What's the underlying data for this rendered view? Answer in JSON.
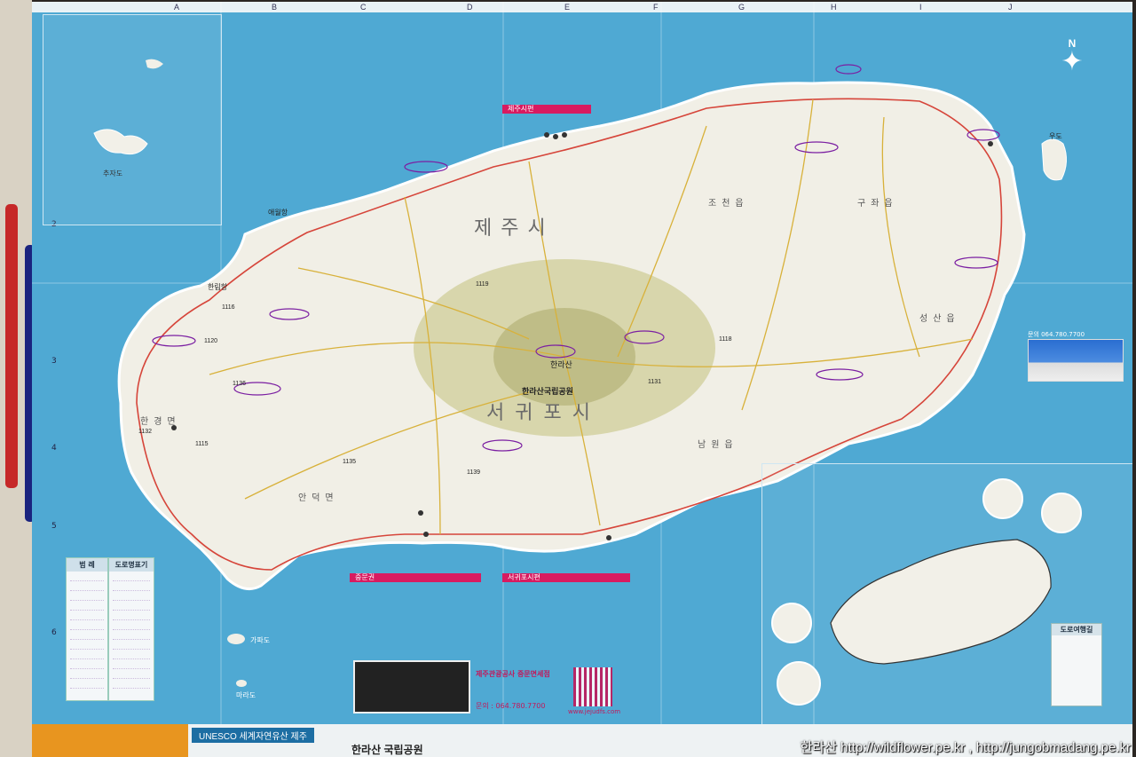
{
  "map": {
    "island_label": "제주시",
    "region_north": "제주시",
    "region_south": "서귀포시",
    "national_park_label": "한라산국립공원",
    "peak_label": "한라산",
    "compass_label": "N",
    "column_letters": [
      "A",
      "B",
      "C",
      "D",
      "E",
      "F",
      "G",
      "H",
      "I",
      "J"
    ],
    "row_numbers": [
      "2",
      "3",
      "4",
      "5",
      "6"
    ],
    "place_labels": {
      "aewol": "애월항",
      "hallim": "한림항",
      "hangyeong": "한경면",
      "andeok": "안덕면",
      "namwon": "남원읍",
      "jocheon": "조천읍",
      "gujwa": "구좌읍",
      "seongsan": "성산읍",
      "udo": "우도",
      "chuja": "추자도",
      "marado": "마라도",
      "gapado": "가파도"
    },
    "route_numbers": [
      "1132",
      "1116",
      "1136",
      "1139",
      "1119",
      "1118",
      "1131",
      "1135",
      "1120",
      "1115"
    ]
  },
  "panels": {
    "legend_title": "범 례",
    "road_sign_title": "도로명표기",
    "jeju_city_title": "제주시편",
    "jungmun_title": "중문권",
    "seogwipo_title": "서귀포시편",
    "road_trip_title": "도로여행길",
    "tourism_office_title": "제주관광공사 중문면세점",
    "tourism_office_phone": "문의 : 064.780.7700",
    "qr_url": "www.jejudfs.com",
    "seongsan_info_phone": "문의 064.780.7700"
  },
  "footer": {
    "unesco": "UNESCO 세계자연유산 제주",
    "hallasan_park": "한라산 국립공원",
    "watermark": "한라산 http://wildflower.pe.kr , http://jungobmadang.pe.kr"
  },
  "colors": {
    "sea": "#4fa9d3",
    "land": "#f1efe6",
    "highland": "#b9b77e",
    "coast_road": "#d6453a",
    "inland_road": "#d8b13a",
    "annotation": "#7b1fa2"
  }
}
